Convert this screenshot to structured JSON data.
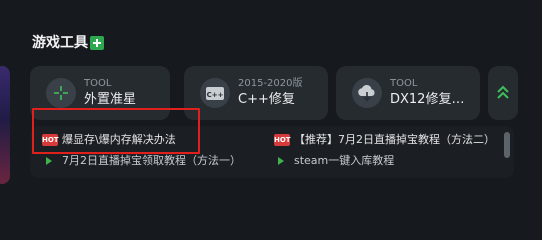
{
  "section": {
    "title": "游戏工具",
    "add_icon": "plus-icon",
    "accent": "#2ea84f"
  },
  "tools": [
    {
      "sub": "TOOL",
      "name": "外置准星",
      "icon": "crosshair-icon"
    },
    {
      "sub": "2015-2020版",
      "name": "C++修复",
      "icon": "cpp-icon"
    },
    {
      "sub": "TOOL",
      "name": "DX12修复工...",
      "icon": "cloud-download-icon"
    }
  ],
  "expand": {
    "icon": "double-chevron-up-icon"
  },
  "news": [
    {
      "badge": "HOT",
      "text": "爆显存\\爆内存解决办法"
    },
    {
      "badge": "HOT",
      "text": "【推荐】7月2日直播掉宝教程（方法二）"
    },
    {
      "badge": "",
      "text": "7月2日直播掉宝领取教程（方法一）"
    },
    {
      "badge": "",
      "text": "steam一键入库教程"
    }
  ],
  "highlight_color": "#e0201c"
}
